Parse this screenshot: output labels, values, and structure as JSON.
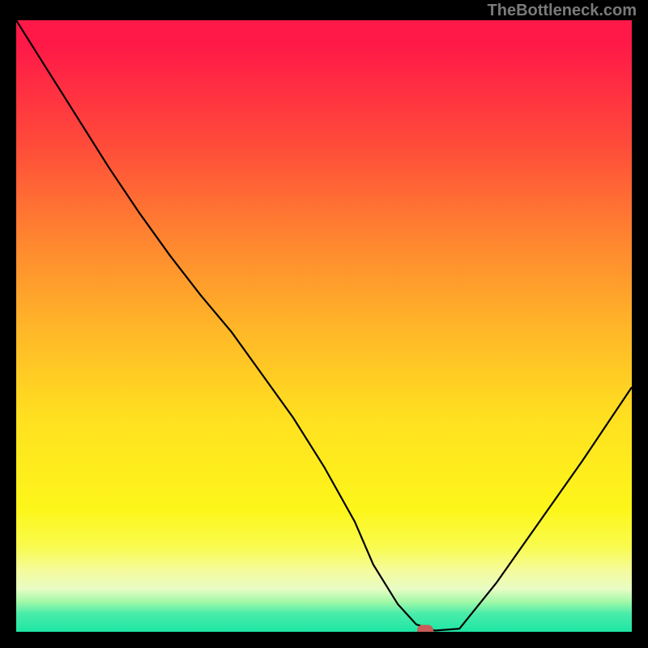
{
  "watermark": "TheBottleneck.com",
  "chart_data": {
    "type": "line",
    "title": "",
    "xlabel": "",
    "ylabel": "",
    "xlim": [
      0,
      100
    ],
    "ylim": [
      0,
      100
    ],
    "x": [
      0,
      5,
      10,
      15,
      20,
      25,
      30,
      35,
      40,
      45,
      50,
      55,
      58,
      62,
      65,
      68,
      72,
      78,
      85,
      92,
      100
    ],
    "values": [
      100,
      92,
      84,
      76,
      68.5,
      61.5,
      55,
      49,
      42,
      35,
      27,
      18,
      11,
      4.5,
      1.2,
      0.2,
      0.5,
      8,
      18,
      28,
      40
    ],
    "marker": {
      "x": 66.5,
      "y": 0.2
    },
    "gradient_colors": [
      "#ff1948",
      "#ff8230",
      "#ffe020",
      "#fdf61a",
      "#1ce6a4"
    ]
  }
}
